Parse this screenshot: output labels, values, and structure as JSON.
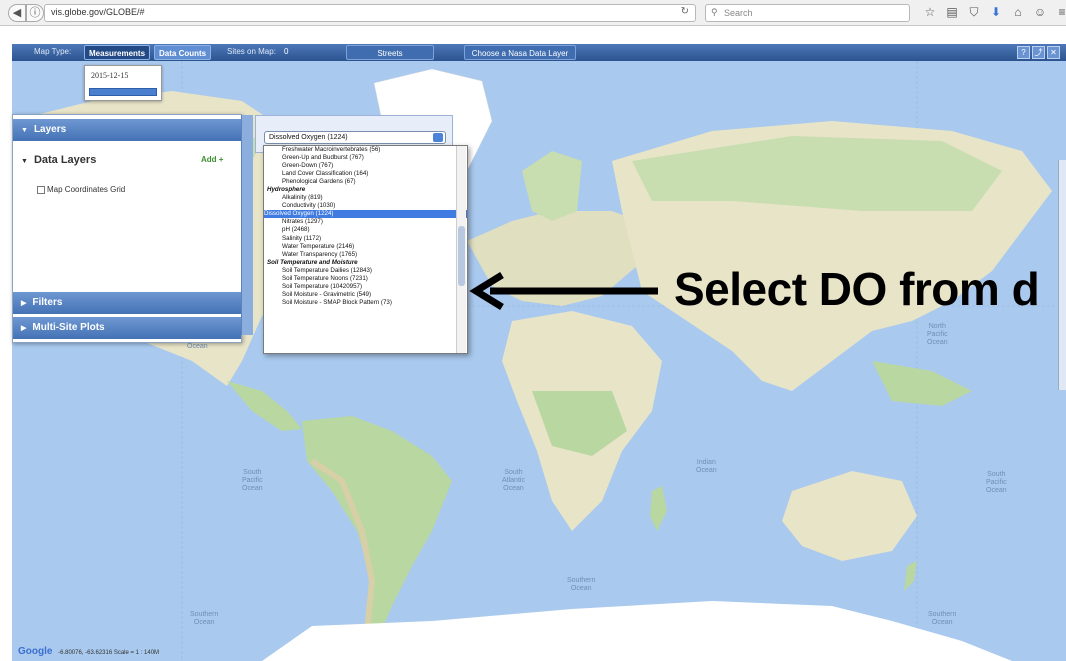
{
  "browser": {
    "url": "vis.globe.gov/GLOBE/#",
    "search_placeholder": "Search",
    "back_icon": "back-arrow-icon",
    "info_icon": "info-icon"
  },
  "toolbar": {
    "map_type_label": "Map Type:",
    "tab_measurements": "Measurements",
    "tab_data_counts": "Data Counts",
    "sites_on_map_label": "Sites on Map:",
    "sites_count": "0",
    "streets_button": "Streets",
    "nasa_layer_button": "Choose a Nasa Data Layer"
  },
  "date_widget": {
    "date": "2015-12-15"
  },
  "left_panel": {
    "layers_header": "Layers",
    "data_layers_title": "Data Layers",
    "add_link": "Add +",
    "coord_grid_label": "Map Coordinates Grid",
    "filters_header": "Filters",
    "multisite_header": "Multi-Site Plots"
  },
  "dropdown": {
    "selected_value": "Dissolved Oxygen (1224)",
    "items": [
      {
        "label": "Freshwater Macroinvertebrates (56)",
        "kind": "option"
      },
      {
        "label": "Green-Up and Budburst (767)",
        "kind": "option"
      },
      {
        "label": "Green-Down (767)",
        "kind": "option"
      },
      {
        "label": "Land Cover Classification (164)",
        "kind": "option"
      },
      {
        "label": "Phenological Gardens (67)",
        "kind": "option"
      },
      {
        "label": "Hydrosphere",
        "kind": "group"
      },
      {
        "label": "Alkalinity (819)",
        "kind": "option"
      },
      {
        "label": "Conductivity (1030)",
        "kind": "option"
      },
      {
        "label": "Dissolved Oxygen (1224)",
        "kind": "selected"
      },
      {
        "label": "Nitrates (1297)",
        "kind": "option"
      },
      {
        "label": "pH (2468)",
        "kind": "option"
      },
      {
        "label": "Salinity (1172)",
        "kind": "option"
      },
      {
        "label": "Water Temperature (2146)",
        "kind": "option"
      },
      {
        "label": "Water Transparency (1765)",
        "kind": "option"
      },
      {
        "label": "Soil Temperature and Moisture",
        "kind": "group"
      },
      {
        "label": "Soil Temperature Dailies (12843)",
        "kind": "option"
      },
      {
        "label": "Soil Temperature Noons (7231)",
        "kind": "option"
      },
      {
        "label": "Soil Temperature (10420957)",
        "kind": "option"
      },
      {
        "label": "Soil Moisture - Gravimetric (549)",
        "kind": "option"
      },
      {
        "label": "Soil Moisture - SMAP Block Pattern (73)",
        "kind": "option"
      }
    ]
  },
  "annotation": {
    "text": "Select DO from d"
  },
  "map": {
    "ocean_labels": [
      "Ocean",
      "South\nPacific\nOcean",
      "South\nAtlantic\nOcean",
      "Indian\nOcean",
      "South\nPacific\nOcean",
      "North\nPacific\nOcean",
      "Southern\nOcean",
      "Southern\nOcean",
      "Southern\nOcean"
    ],
    "credit": "-6.80076, -63.62316 Scale = 1 : 140M",
    "google": "Google",
    "colors": {
      "ocean": "#a9c9ee",
      "land": "#e8e4c8",
      "green": "#b9d7a0",
      "ice": "#ffffff"
    }
  }
}
